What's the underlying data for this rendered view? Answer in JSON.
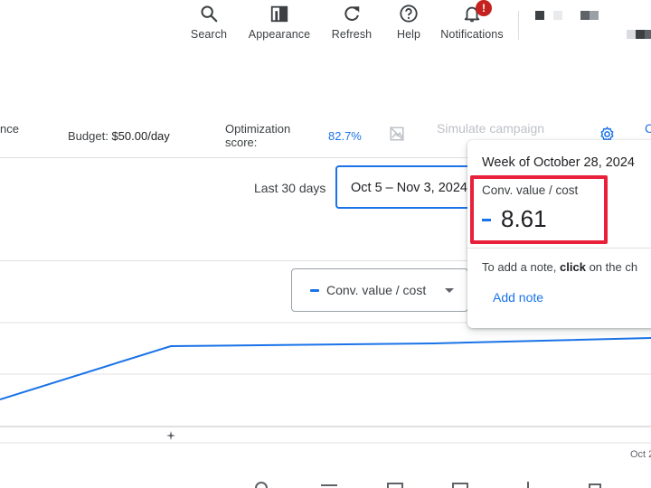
{
  "toolbar": {
    "search_label": "Search",
    "appearance_label": "Appearance",
    "refresh_label": "Refresh",
    "help_label": "Help",
    "notifications_label": "Notifications",
    "notification_badge": "!"
  },
  "campaign_info": {
    "partial_label": "nce",
    "budget_label": "Budget:",
    "budget_value": "$50.00/day",
    "optimization_label_line1": "Optimization",
    "optimization_label_line2": "score:",
    "optimization_value": "82.7%",
    "simulate_label": "Simulate campaign",
    "partial_link": "C"
  },
  "date_range": {
    "preset_label": "Last 30 days",
    "range_value": "Oct 5 – Nov 3, 2024"
  },
  "chart": {
    "metric_selector_label": "Conv. value / cost",
    "x_tick_partial": "Oct 2",
    "series_color": "#1a73e8"
  },
  "chart_data": {
    "type": "line",
    "series": [
      {
        "name": "Conv. value / cost",
        "values": [
          null,
          null,
          8.61
        ]
      }
    ],
    "ylabel": "",
    "xlabel": ""
  },
  "tooltip": {
    "week_label": "Week of October 28, 2024",
    "metric_label": "Conv. value / cost",
    "value": "8.61",
    "note_prefix": "To add a note,",
    "note_bold": "click",
    "note_suffix": "on the ch",
    "add_note_label": "Add note"
  },
  "colors": {
    "accent": "#1a73e8",
    "highlight": "#e8203a",
    "badge": "#c5221f"
  }
}
